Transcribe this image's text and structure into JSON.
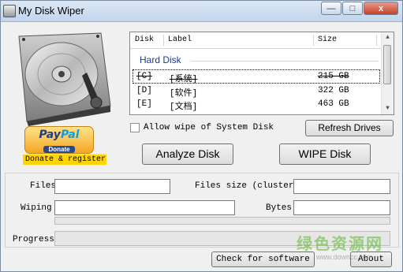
{
  "window": {
    "title": "My Disk Wiper",
    "minimize": "—",
    "maximize": "□",
    "close": "x"
  },
  "donate": {
    "paypal_a": "Pay",
    "paypal_b": "Pal",
    "paypal_sub": "Donate",
    "label": "Donate & register"
  },
  "disk_list": {
    "columns": [
      "Disk",
      "Label",
      "Size"
    ],
    "group": "Hard Disk",
    "rows": [
      {
        "disk": "[C]",
        "label": "[系统]",
        "size": "215 GB"
      },
      {
        "disk": "[D]",
        "label": "[软件]",
        "size": "322 GB"
      },
      {
        "disk": "[E]",
        "label": "[文档]",
        "size": "463 GB"
      }
    ]
  },
  "options": {
    "allow_system_wipe_label": "Allow wipe of System Disk",
    "allow_system_wipe_checked": false
  },
  "buttons": {
    "refresh": "Refresh Drives",
    "analyze": "Analyze Disk",
    "wipe": "WIPE Disk",
    "check_updates": "Check for software",
    "about": "About"
  },
  "status": {
    "files_label": "Files",
    "files_value": "",
    "files_size_label": "Files size (cluster,",
    "files_size_value": "",
    "wiping_label": "Wiping",
    "wiping_value": "",
    "bytes_label": "Bytes",
    "bytes_value": "",
    "progress_label": "Progress",
    "progress_value": ""
  },
  "watermark": {
    "text": "绿色资源网",
    "url": "www.downcc.com"
  },
  "colors": {
    "group_header": "#1e3b8c",
    "donate_bg": "#ffd400"
  }
}
